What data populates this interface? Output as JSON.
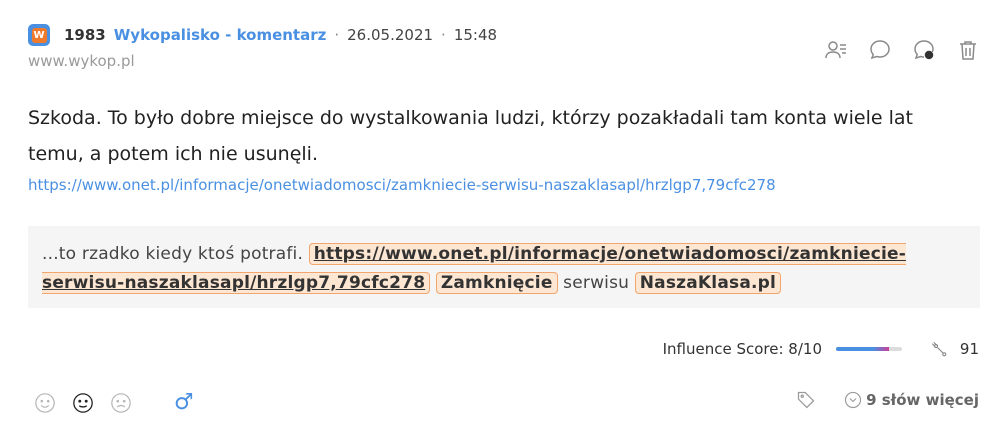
{
  "header": {
    "year": "1983",
    "source_name": "Wykopalisko - komentarz",
    "date": "26.05.2021",
    "time": "15:48",
    "separator": "·",
    "domain": "www.wykop.pl",
    "source_icon": "wykop-logo-icon"
  },
  "actions": [
    {
      "name": "author-list-icon"
    },
    {
      "name": "comment-icon"
    },
    {
      "name": "comment-search-icon"
    },
    {
      "name": "trash-icon"
    }
  ],
  "content": {
    "text": "Szkoda. To było dobre miejsce do wystalkowania ludzi, którzy pozakładali tam konta wiele lat temu, a potem ich nie usunęli.",
    "link": "https://www.onet.pl/informacje/onetwiadomosci/zamkniecie-serwisu-naszaklasapl/hrzlgp7,79cfc278"
  },
  "quote": {
    "prefix": "...to rzadko kiedy ktoś potrafi.",
    "highlight_link": "https://www.onet.pl/informacje/onetwiadomosci/zamkniecie-serwisu-naszaklasapl/hrzlgp7,79cfc278",
    "highlight_word1": "Zamknięcie",
    "middle": "serwisu",
    "highlight_word2": "NaszaKlasa.pl"
  },
  "stats": {
    "influence_label": "Influence Score: 8/10",
    "influence_value": 0.8,
    "count": "91"
  },
  "footer": {
    "more_label": "9 słów więcej",
    "gender_symbol": "♂"
  },
  "colors": {
    "accent": "#4a90e2",
    "highlight_bg": "#fde6d2",
    "highlight_border": "#f2a66f"
  }
}
